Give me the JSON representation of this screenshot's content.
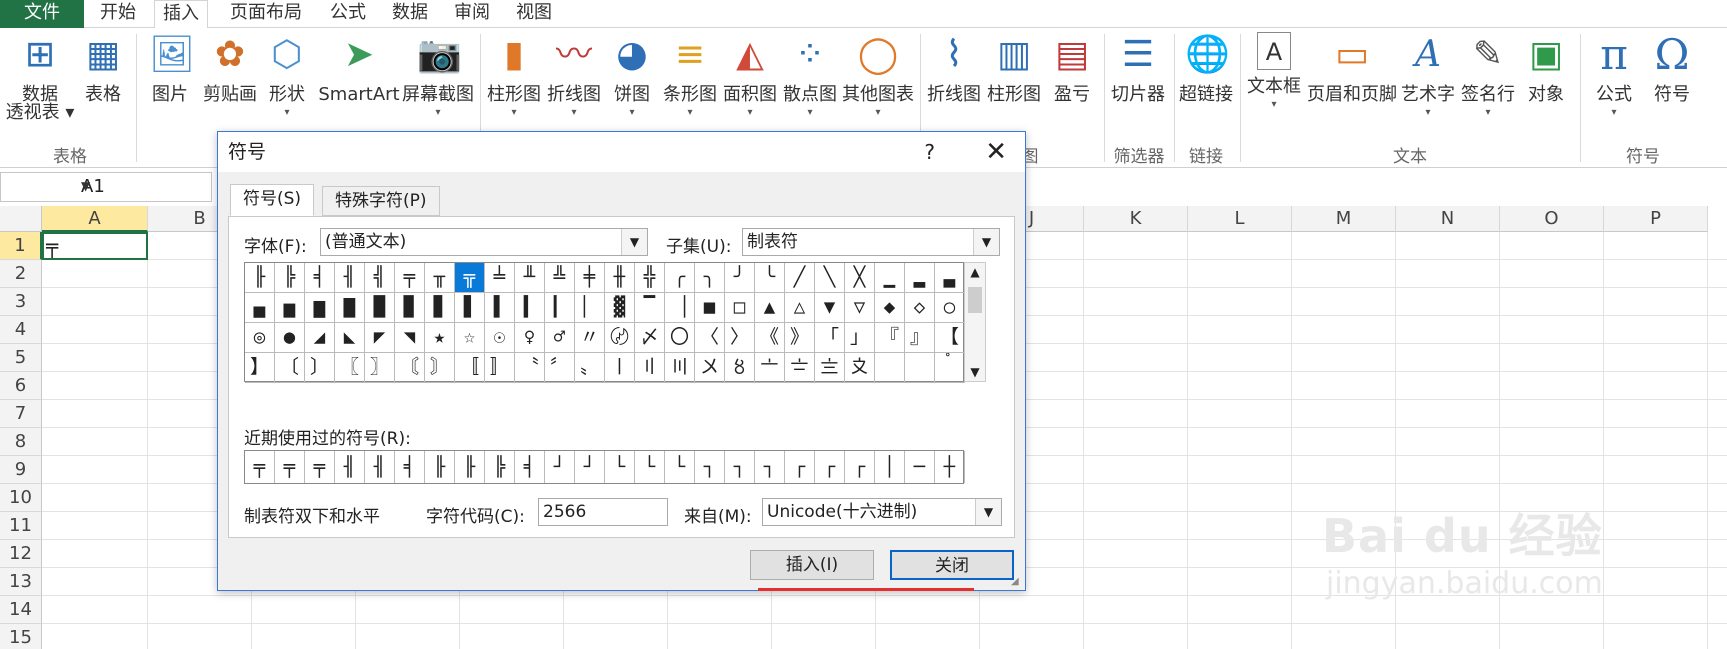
{
  "ribbon_tabs": [
    "文件",
    "开始",
    "插入",
    "页面布局",
    "公式",
    "数据",
    "审阅",
    "视图"
  ],
  "ribbon": {
    "buttons": [
      {
        "label": "数据透视表",
        "sub": "透视表",
        "main": "数据",
        "icon": "pivot-table-icon",
        "glyph": "⊞"
      },
      {
        "label": "表格",
        "icon": "table-icon",
        "glyph": "▦"
      },
      {
        "label": "图片",
        "icon": "picture-icon",
        "glyph": "🖼"
      },
      {
        "label": "剪贴画",
        "icon": "clipart-icon",
        "glyph": "✿"
      },
      {
        "label": "形状",
        "icon": "shapes-icon",
        "glyph": "⬡"
      },
      {
        "label": "SmartArt",
        "icon": "smartart-icon",
        "glyph": "➤"
      },
      {
        "label": "屏幕截图",
        "icon": "screenshot-icon",
        "glyph": "📷"
      },
      {
        "label": "柱形图",
        "icon": "column-chart-icon",
        "glyph": "▮"
      },
      {
        "label": "折线图",
        "icon": "line-chart-icon",
        "glyph": "〰"
      },
      {
        "label": "饼图",
        "icon": "pie-chart-icon",
        "glyph": "◕"
      },
      {
        "label": "条形图",
        "icon": "bar-chart-icon",
        "glyph": "≡"
      },
      {
        "label": "面积图",
        "icon": "area-chart-icon",
        "glyph": "◭"
      },
      {
        "label": "散点图",
        "icon": "scatter-chart-icon",
        "glyph": "⁘"
      },
      {
        "label": "其他图表",
        "icon": "other-charts-icon",
        "glyph": "◯"
      },
      {
        "label": "折线图",
        "icon": "sparkline-line-icon",
        "glyph": "⌇"
      },
      {
        "label": "柱形图",
        "icon": "sparkline-column-icon",
        "glyph": "▥"
      },
      {
        "label": "盈亏",
        "icon": "winloss-icon",
        "glyph": "▤"
      },
      {
        "label": "切片器",
        "icon": "slicer-icon",
        "glyph": "☰"
      },
      {
        "label": "超链接",
        "icon": "hyperlink-icon",
        "glyph": "🌐"
      },
      {
        "label": "文本框",
        "icon": "textbox-icon",
        "glyph": "A"
      },
      {
        "label": "页眉和页脚",
        "icon": "header-footer-icon",
        "glyph": "▭"
      },
      {
        "label": "艺术字",
        "icon": "wordart-icon",
        "glyph": "A"
      },
      {
        "label": "签名行",
        "icon": "signature-icon",
        "glyph": "✎"
      },
      {
        "label": "对象",
        "icon": "object-icon",
        "glyph": "▣"
      },
      {
        "label": "公式",
        "icon": "equation-icon",
        "glyph": "π"
      },
      {
        "label": "符号",
        "icon": "symbol-icon",
        "glyph": "Ω"
      }
    ],
    "groups": [
      "表格",
      "图",
      "筛选器",
      "链接",
      "文本",
      "符号"
    ]
  },
  "namebox": {
    "value": "A1"
  },
  "columns": [
    "A",
    "B",
    "",
    "",
    "",
    "",
    "",
    "",
    "",
    "J",
    "K",
    "L",
    "M",
    "N",
    "O",
    "P"
  ],
  "rows": [
    "1",
    "2",
    "3",
    "4",
    "5",
    "6",
    "7",
    "8",
    "9",
    "10",
    "11",
    "12",
    "13",
    "14",
    "15"
  ],
  "cell_a1": "╤",
  "dialog": {
    "title": "符号",
    "help": "?",
    "close": "✕",
    "tabs": [
      "符号(S)",
      "特殊字符(P)"
    ],
    "font_label": "字体(F):",
    "font_value": "(普通文本)",
    "subset_label": "子集(U):",
    "subset_value": "制表符",
    "symbols": [
      "╟",
      "╠",
      "╡",
      "╢",
      "╣",
      "╤",
      "╥",
      "╦",
      "╧",
      "╨",
      "╩",
      "╪",
      "╫",
      "╬",
      "╭",
      "╮",
      "╯",
      "╰",
      "╱",
      "╲",
      "╳",
      "▁",
      "▂",
      "▃",
      "▄",
      "▅",
      "▆",
      "▇",
      "█",
      "▉",
      "▊",
      "▋",
      "▌",
      "▍",
      "▎",
      "▏",
      "▓",
      "▔",
      "▕",
      "■",
      "□",
      "▲",
      "△",
      "▼",
      "▽",
      "◆",
      "◇",
      "○",
      "◎",
      "●",
      "◢",
      "◣",
      "◤",
      "◥",
      "★",
      "☆",
      "☉",
      "♀",
      "♂",
      "〃",
      "〄",
      "〆",
      "〇",
      "〈",
      "〉",
      "《",
      "》",
      "「",
      "」",
      "『",
      "』",
      "【",
      "】",
      "〔",
      "〕",
      "〖",
      "〗",
      "〘",
      "〙",
      "〚",
      "〛",
      "〝",
      "〞",
      "〟",
      "〡",
      "〢",
      "〣",
      "〤",
      "〥",
      "〦",
      "〧",
      "〨",
      "〩",
      "〪",
      "〫",
      "〬"
    ],
    "recent_label": "近期使用过的符号(R):",
    "recent": [
      "╤",
      "╤",
      "╤",
      "╢",
      "╢",
      "╡",
      "╟",
      "╟",
      "╠",
      "╡",
      "┘",
      "┘",
      "└",
      "└",
      "└",
      "┐",
      "┐",
      "┐",
      "┌",
      "┌",
      "┌",
      "│",
      "─",
      "┼"
    ],
    "desc": "制表符双下和水平",
    "charcode_label": "字符代码(C):",
    "charcode_value": "2566",
    "from_label": "来自(M):",
    "from_value": "Unicode(十六进制)",
    "insert_button": "插入(I)",
    "close_button": "关闭"
  },
  "watermark": {
    "line1": "Bai du 经验",
    "line2": "jingyan.baidu.com"
  }
}
